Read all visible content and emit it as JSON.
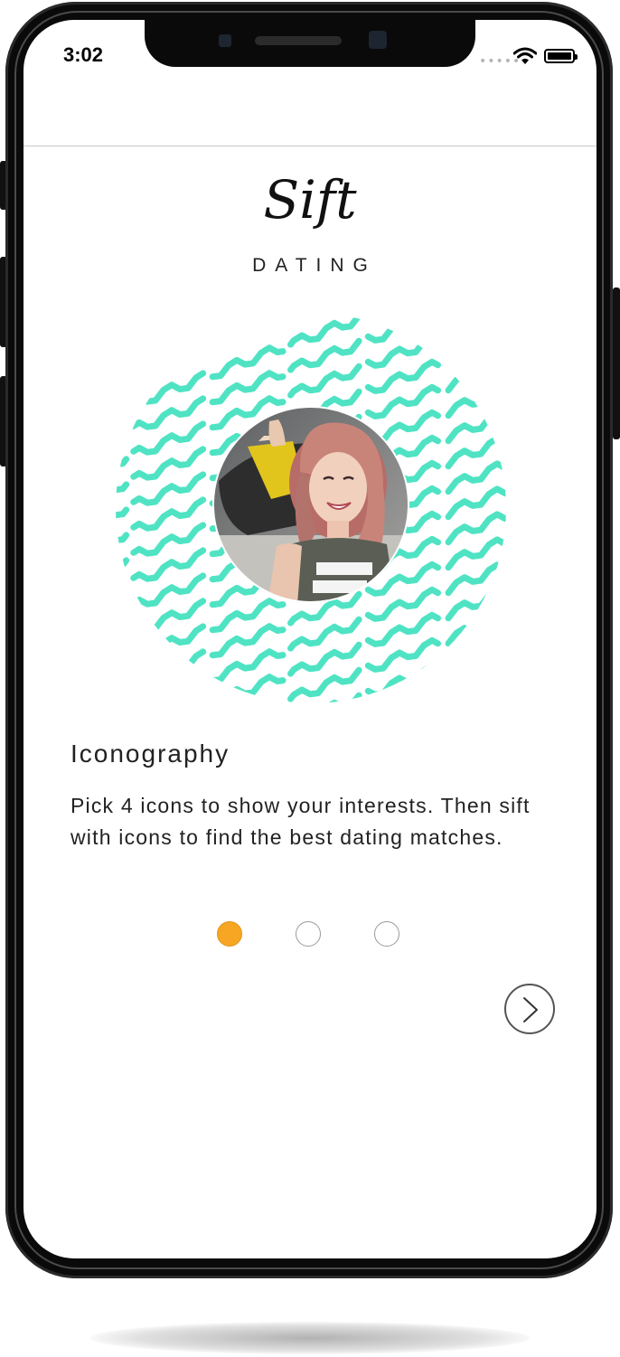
{
  "status_bar": {
    "time": "3:02",
    "signal": "•••••",
    "icons": [
      "cellular-signal-icon",
      "wifi-icon",
      "battery-icon"
    ]
  },
  "brand": {
    "logo_text": "Sift",
    "tagline": "DATING"
  },
  "hero": {
    "image": "profile-photo-woman-with-skateboard",
    "pattern": "wavy-lines-circle",
    "pattern_color": "#4fe3c4"
  },
  "onboarding": {
    "title": "Iconography",
    "description": "Pick 4 icons to show your interests. Then sift with icons to find the best dating matches.",
    "pagination": {
      "total": 3,
      "current": 1,
      "active_color": "#f6a623"
    },
    "next_icon": "chevron-right-icon"
  }
}
